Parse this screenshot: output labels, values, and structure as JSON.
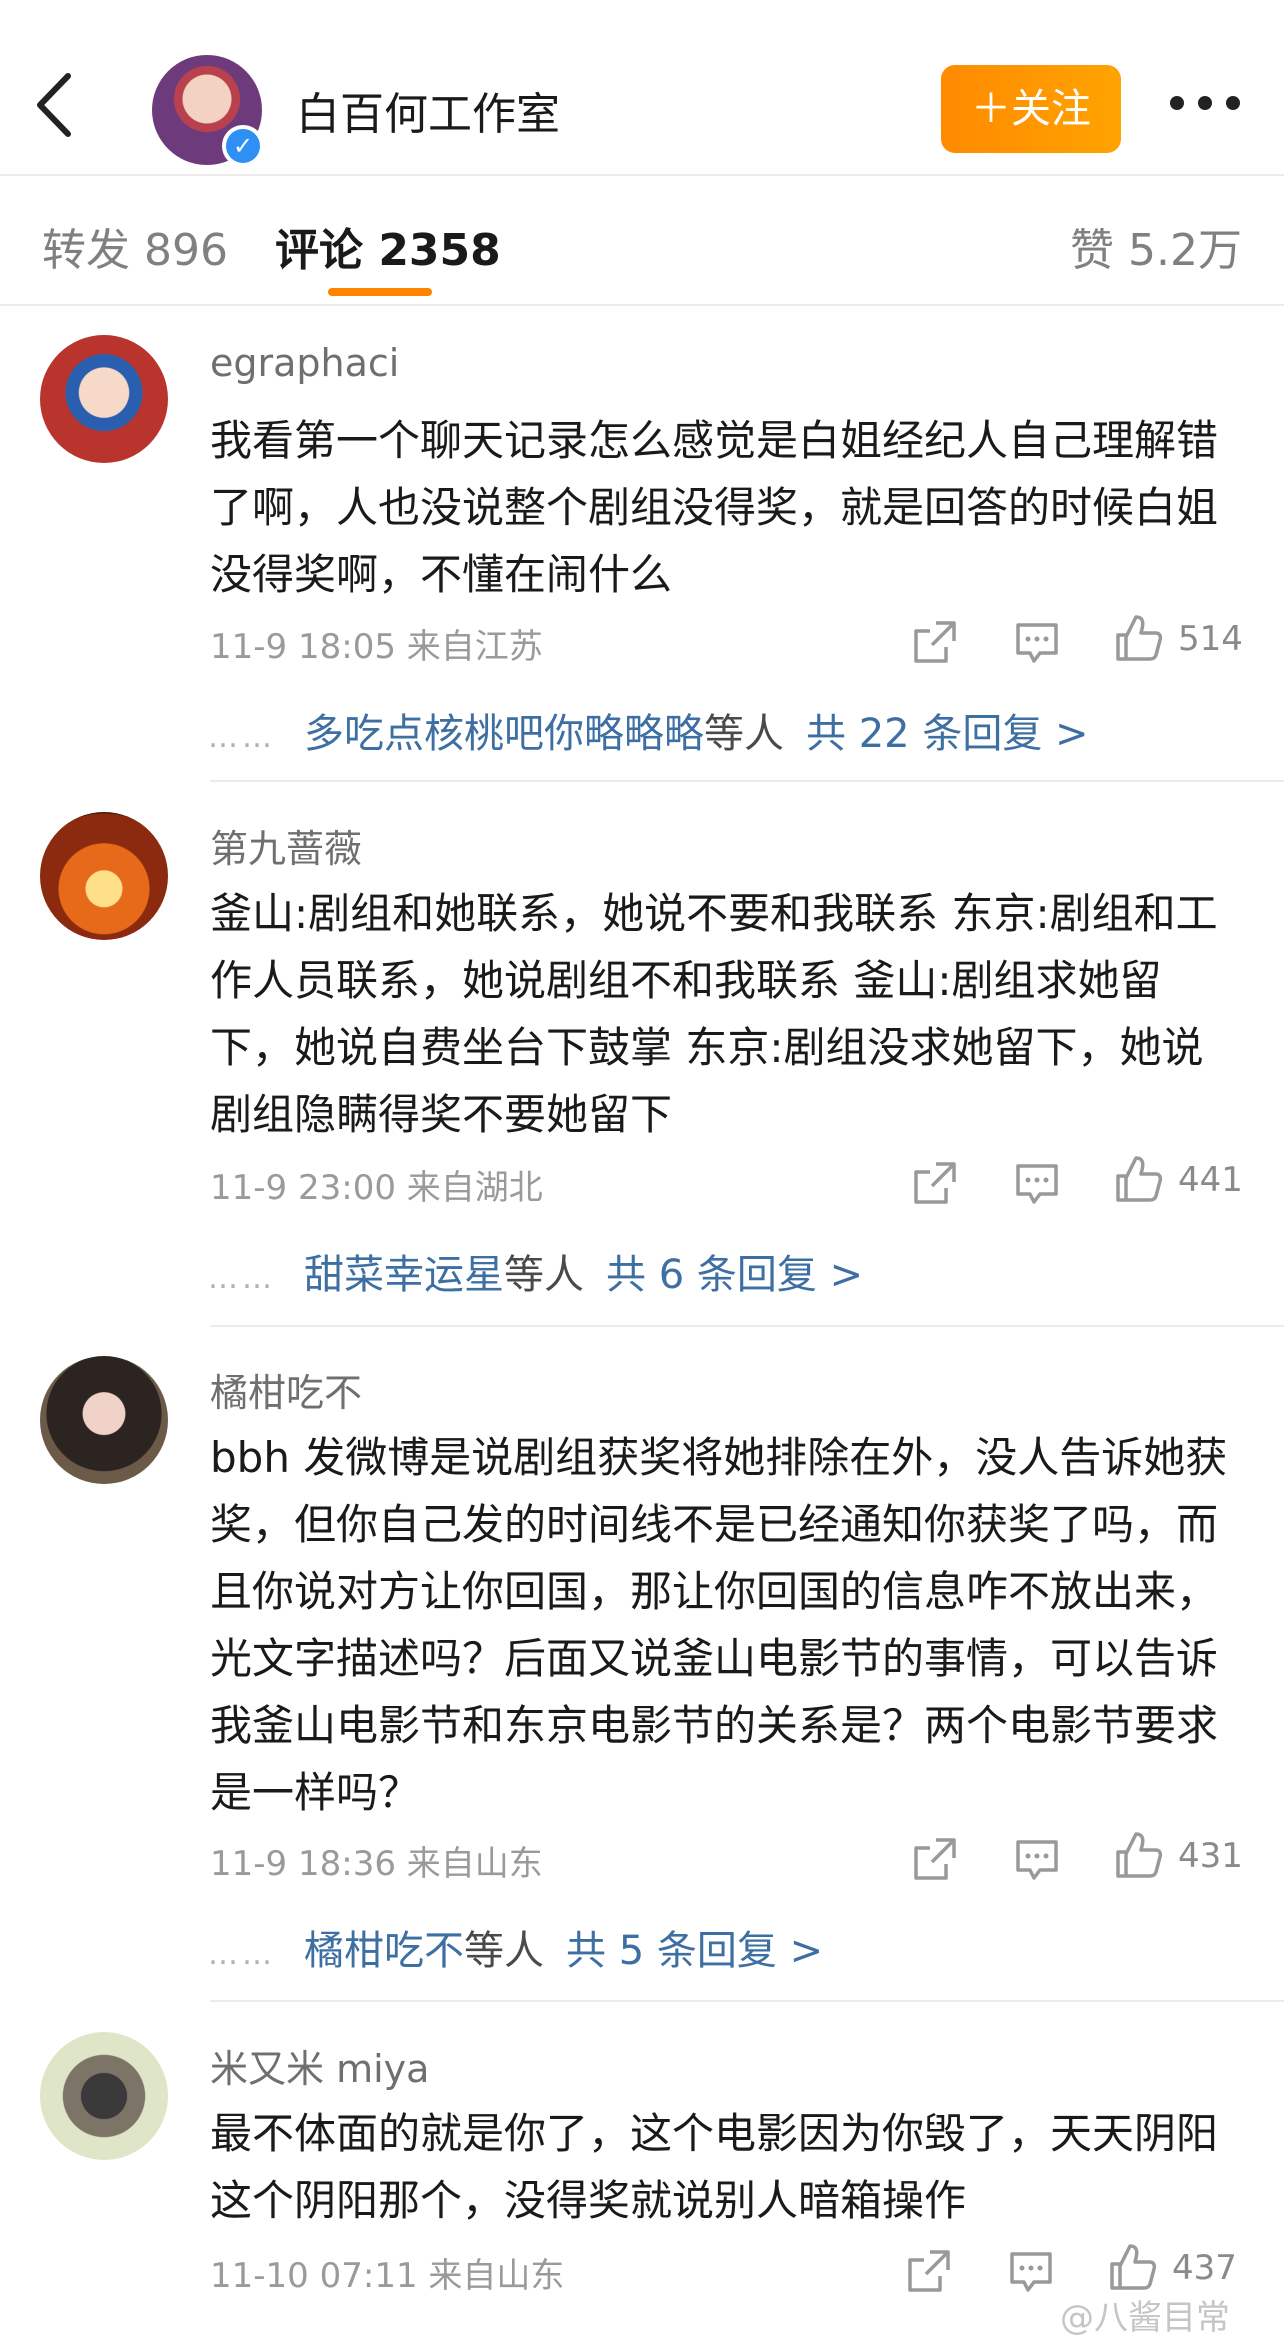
{
  "header": {
    "account_name": "白百何工作室",
    "follow_label": "＋关注",
    "verified_badge": "✓"
  },
  "tabs": [
    {
      "label": "转发 896"
    },
    {
      "label": "评论 2358"
    },
    {
      "label": "赞 5.2万"
    }
  ],
  "comments": [
    {
      "name": "egraphaci",
      "text": "我看第一个聊天记录怎么感觉是白姐经纪人自己理解错了啊，人也没说整个剧组没得奖，就是回答的时候白姐没得奖啊，不懂在闹什么",
      "meta": "11-9 18:05 来自江苏",
      "likes": "514",
      "reply_user": "多吃点核桃吧你略略略",
      "reply_mid": "等人",
      "reply_count": "共 22 条回复 >"
    },
    {
      "name": "第九蔷薇",
      "text": "釜山:剧组和她联系，她说不要和我联系 东京:剧组和工作人员联系，她说剧组不和我联系 釜山:剧组求她留下，她说自费坐台下鼓掌 东京:剧组没求她留下，她说剧组隐瞒得奖不要她留下",
      "meta": "11-9 23:00 来自湖北",
      "likes": "441",
      "reply_user": "甜菜幸运星",
      "reply_mid": "等人",
      "reply_count": "共 6 条回复 >"
    },
    {
      "name": "橘柑吃不",
      "text": "bbh 发微博是说剧组获奖将她排除在外，没人告诉她获奖，但你自己发的时间线不是已经通知你获奖了吗，而且你说对方让你回国，那让你回国的信息咋不放出来，光文字描述吗？后面又说釜山电影节的事情，可以告诉我釜山电影节和东京电影节的关系是？两个电影节要求是一样吗？",
      "meta": "11-9 18:36 来自山东",
      "likes": "431",
      "reply_user": "橘柑吃不",
      "reply_mid": "等人",
      "reply_count": "共 5 条回复 >"
    },
    {
      "name": "米又米 miya",
      "text": "最不体面的就是你了，这个电影因为你毁了，天天阴阳这个阴阳那个，没得奖就说别人暗箱操作",
      "meta": "11-10 07:11 来自山东",
      "likes": "437"
    }
  ],
  "watermark": "@八酱目常",
  "reply_dots": "……",
  "icons": [
    "back-icon",
    "more-icon",
    "share-icon",
    "comment-icon",
    "like-icon"
  ]
}
